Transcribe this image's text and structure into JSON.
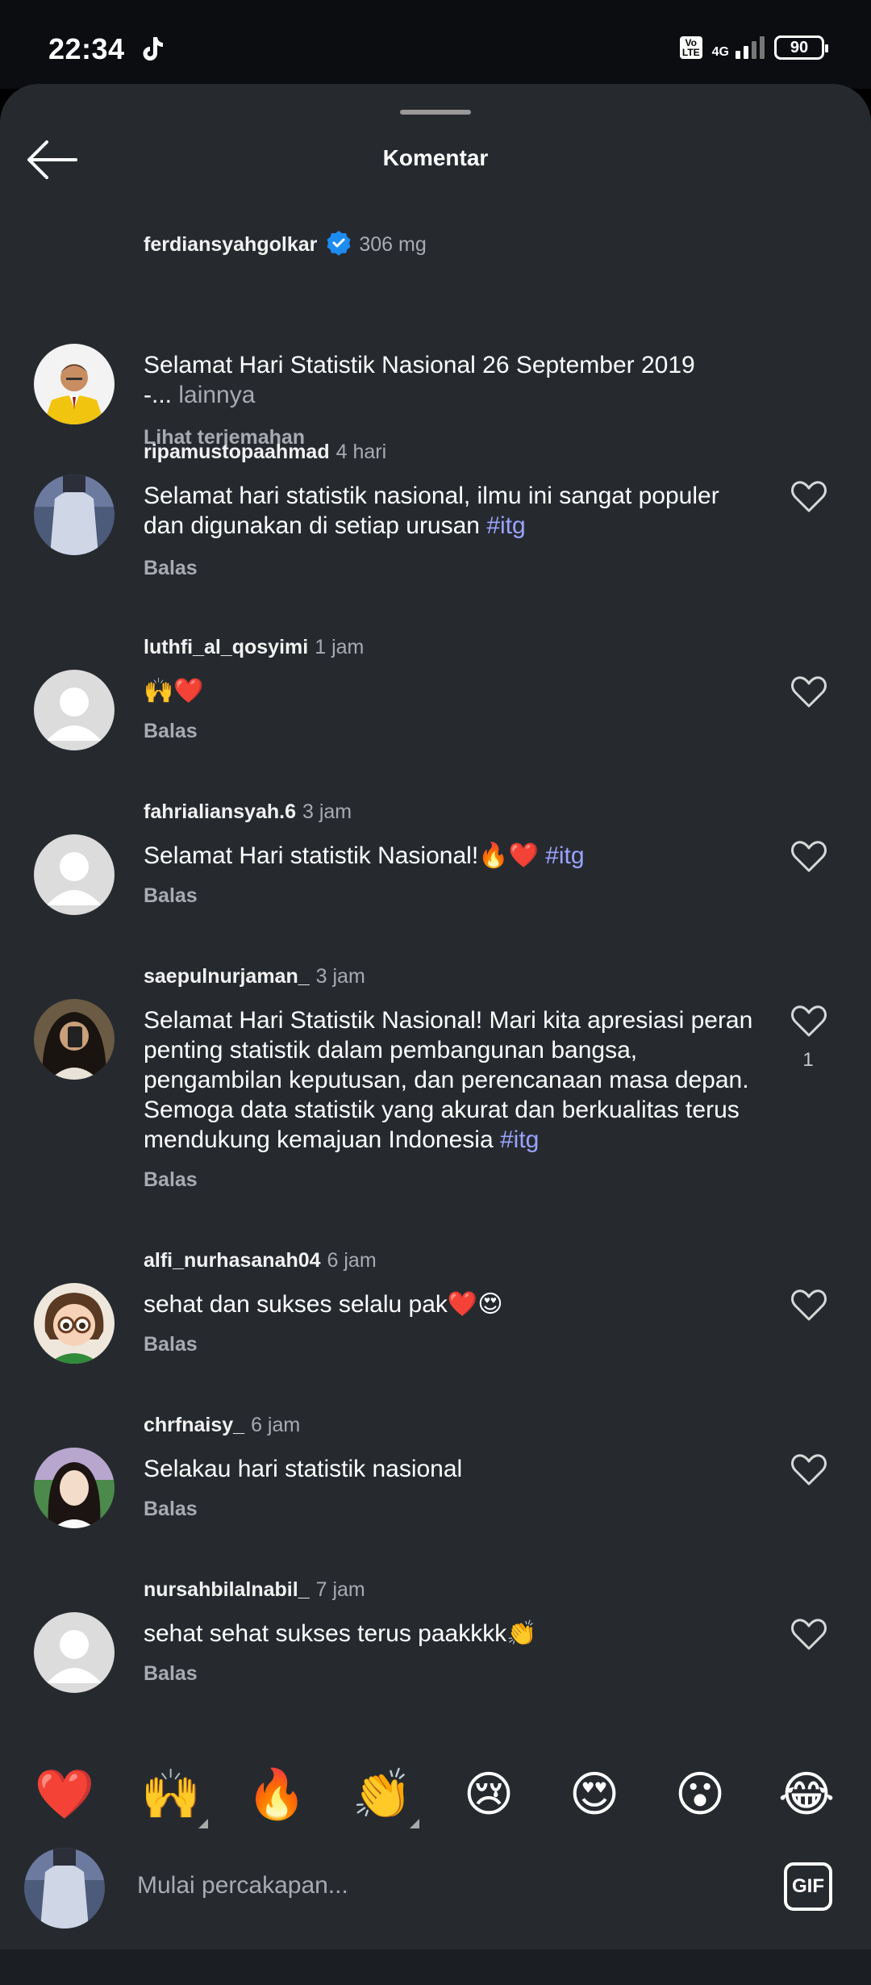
{
  "status": {
    "time": "22:34",
    "volte": "Vo LTE",
    "network": "4G",
    "battery": "90"
  },
  "header": {
    "title": "Komentar"
  },
  "comments": [
    {
      "user": "ferdiansyahgolkar",
      "time": "306 mg",
      "text": "Selamat Hari Statistik Nasional 26 September 2019",
      "more_prefix": "-... ",
      "more": "lainnya",
      "action": "Lihat terjemahan"
    },
    {
      "user": "ripamustopaahmad",
      "time": "4 hari",
      "text": "Selamat hari statistik nasional, ilmu ini sangat populer dan digunakan di setiap urusan ",
      "hashtag": "#itg",
      "action": "Balas"
    },
    {
      "user": "luthfi_al_qosyimi",
      "time": "1 jam",
      "text": "🙌❤️",
      "action": "Balas"
    },
    {
      "user": "fahrialiansyah.6",
      "time": "3 jam",
      "text": "Selamat Hari statistik Nasional!🔥❤️ ",
      "hashtag": "#itg",
      "action": "Balas"
    },
    {
      "user": "saepulnurjaman_",
      "time": "3 jam",
      "text": "Selamat Hari Statistik Nasional! Mari kita apresiasi peran penting statistik dalam pembangunan bangsa, pengambilan keputusan, dan perencanaan masa depan. Semoga data statistik yang akurat dan berkualitas terus mendukung kemajuan Indonesia ",
      "hashtag": "#itg",
      "action": "Balas",
      "likes": "1"
    },
    {
      "user": "alfi_nurhasanah04",
      "time": "6 jam",
      "text": "sehat dan sukses selalu pak❤️😍",
      "action": "Balas"
    },
    {
      "user": "chrfnaisy_",
      "time": "6 jam",
      "text": "Selakau hari statistik nasional",
      "action": "Balas"
    },
    {
      "user": "nursahbilalnabil_",
      "time": "7 jam",
      "text": "sehat sehat sukses terus paakkkk👏",
      "action": "Balas"
    }
  ],
  "reactions": [
    "❤️",
    "🙌",
    "🔥",
    "👏",
    "😢",
    "😍",
    "😮",
    "😂"
  ],
  "composer": {
    "placeholder": "Mulai percakapan...",
    "gif_label": "GIF"
  },
  "colors": {
    "sheet": "#262a2f",
    "hashtag": "#9aa3ff",
    "verified": "#1d8cf0",
    "muted": "#a8acb2"
  }
}
